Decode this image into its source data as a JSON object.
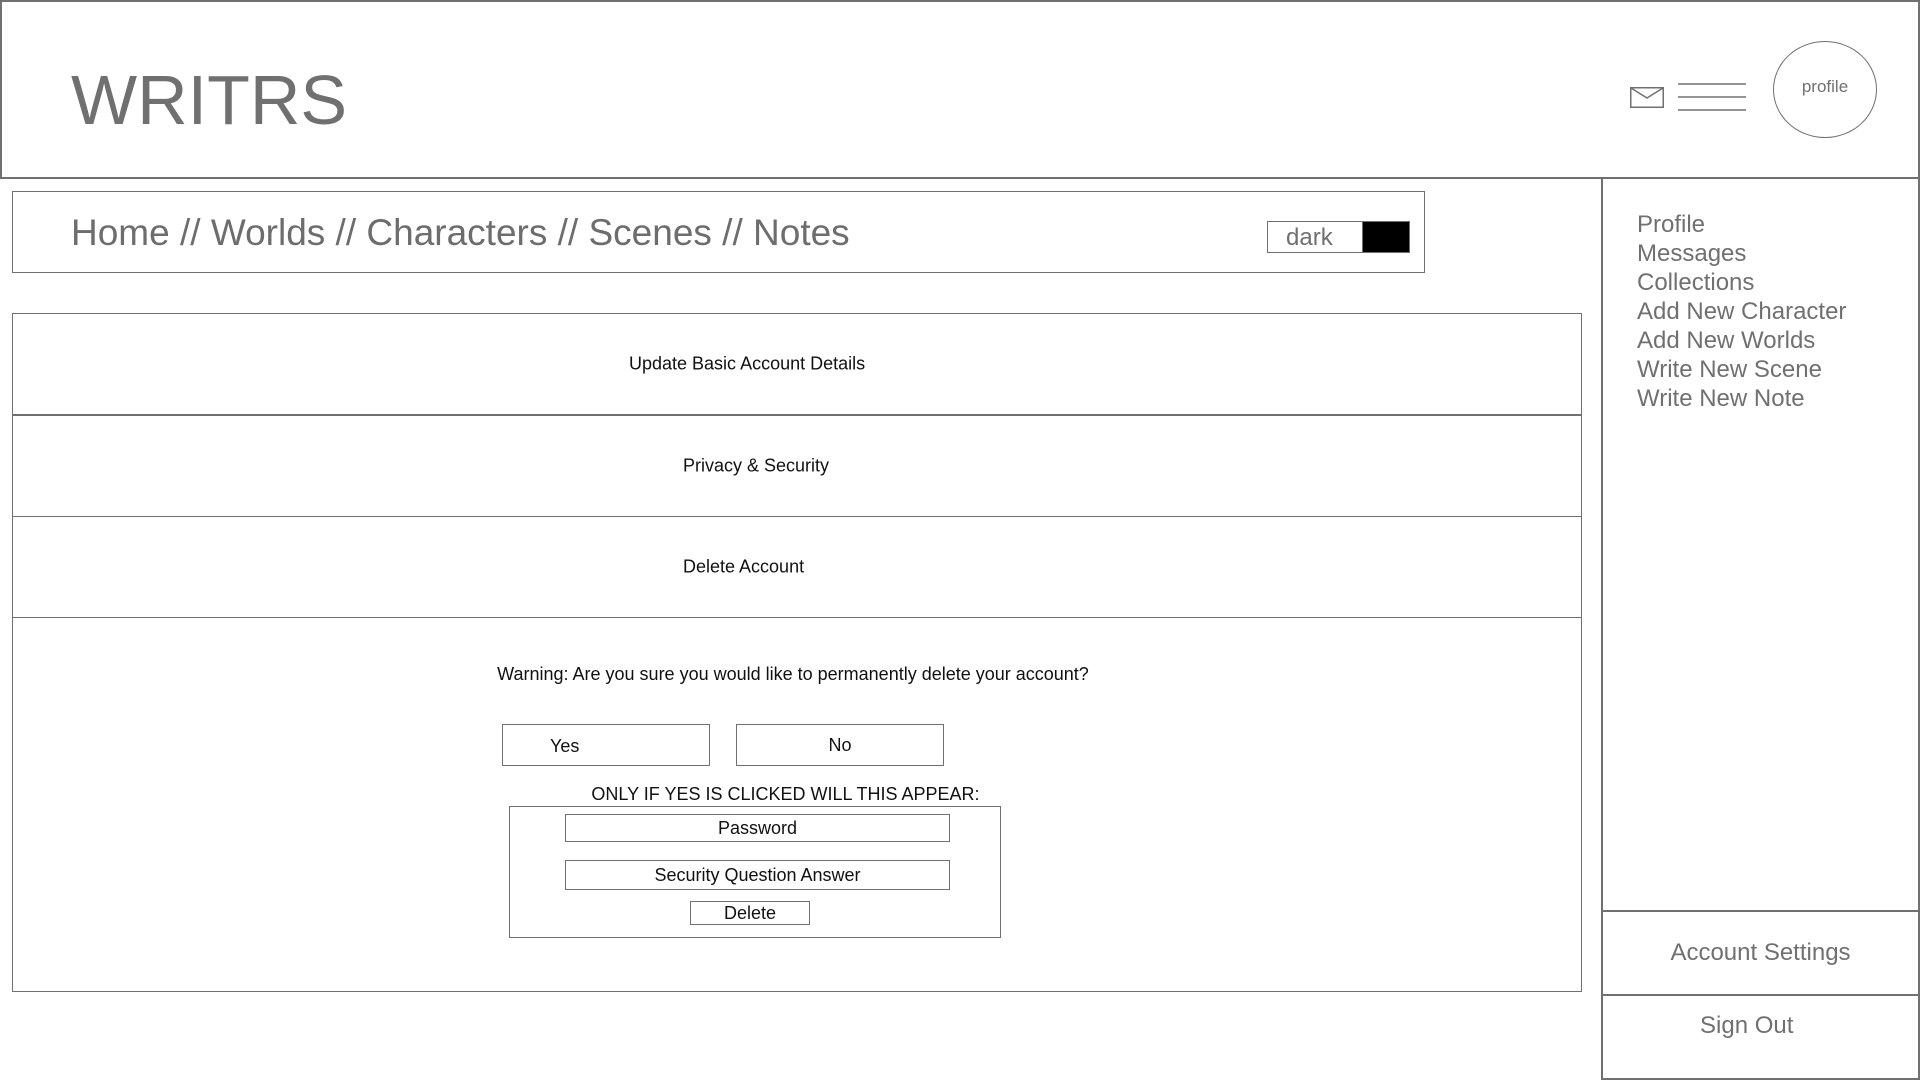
{
  "header": {
    "logo": "WRITRS",
    "icons": {
      "mail": "mail-icon",
      "menu": "hamburger-menu-icon"
    },
    "profile_label": "profile"
  },
  "breadcrumb": {
    "items": [
      "Home",
      "Worlds",
      "Characters",
      "Scenes",
      "Notes"
    ],
    "separator": " // "
  },
  "theme_toggle": {
    "label": "dark",
    "knob_color": "#000000"
  },
  "settings": {
    "rows": [
      {
        "label": "Update Basic Account Details"
      },
      {
        "label": "Privacy & Security"
      },
      {
        "label": "Delete Account"
      }
    ],
    "delete_panel": {
      "warning": "Warning: Are you sure you would like to permanently delete your account?",
      "yes_label": "Yes",
      "no_label": "No",
      "conditional_note": "ONLY IF YES IS CLICKED WILL THIS APPEAR:",
      "password_placeholder": "Password",
      "security_answer_placeholder": "Security Question Answer",
      "delete_label": "Delete"
    }
  },
  "sidebar": {
    "items": [
      {
        "label": "Profile"
      },
      {
        "label": "Messages"
      },
      {
        "label": "Collections"
      },
      {
        "label": "Add New Character"
      },
      {
        "label": "Add New Worlds"
      },
      {
        "label": "Write New Scene"
      },
      {
        "label": "Write New Note"
      }
    ],
    "account_settings_label": "Account Settings",
    "sign_out_label": "Sign Out"
  },
  "colors": {
    "line": "#707070",
    "text_gray": "#707070",
    "text_dark": "#111111"
  }
}
